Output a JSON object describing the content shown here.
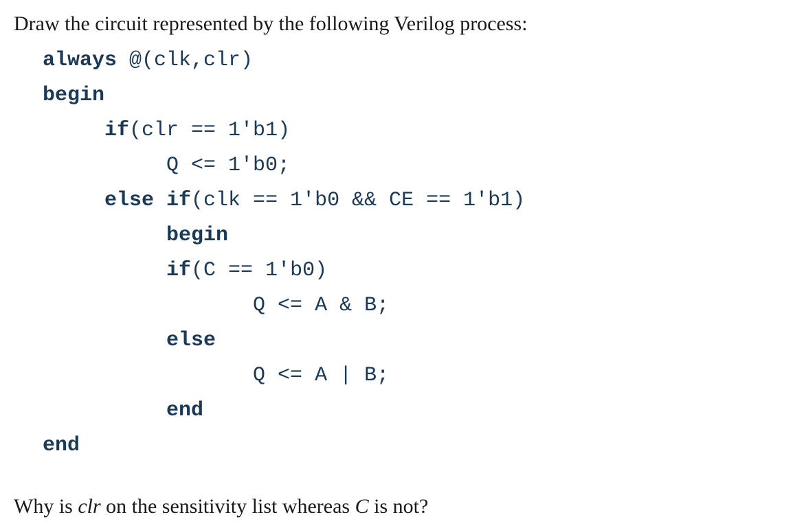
{
  "prompt": "Draw the circuit represented by the following Verilog process:",
  "code": {
    "l1a": "always",
    "l1b": " @(clk,clr)",
    "l2": "begin",
    "l3a": "     ",
    "l3b": "if",
    "l3c": "(clr == 1'b1)",
    "l4": "          Q <= 1'b0;",
    "l5a": "     ",
    "l5b": "else if",
    "l5c": "(clk == 1'b0 && CE == 1'b1)",
    "l6a": "          ",
    "l6b": "begin",
    "l7a": "          ",
    "l7b": "if",
    "l7c": "(C == 1'b0)",
    "l8": "                 Q <= A & B;",
    "l9a": "          ",
    "l9b": "else",
    "l10": "                 Q <= A | B;",
    "l11a": "          ",
    "l11b": "end",
    "l12": "end"
  },
  "question": {
    "p1": "Why is ",
    "clr": "clr",
    "p2": " on the sensitivity list whereas ",
    "c": "C",
    "p3": " is not?"
  }
}
